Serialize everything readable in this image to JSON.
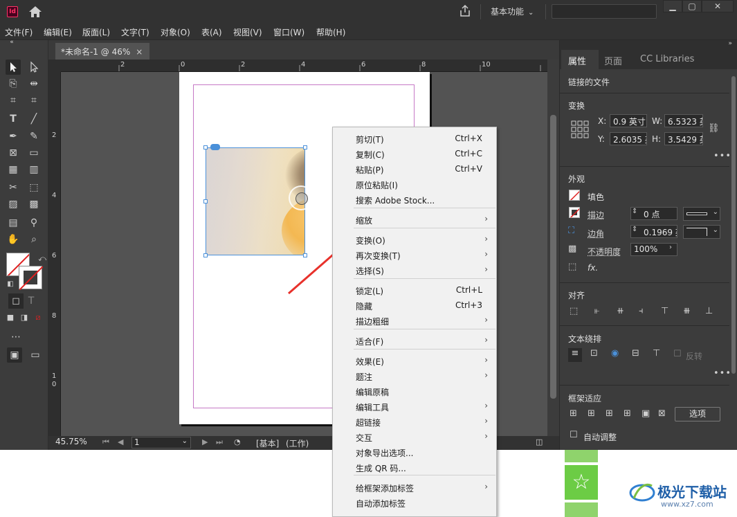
{
  "app": {
    "logo_text": "Id",
    "workspace": "基本功能"
  },
  "menubar": [
    "文件(F)",
    "编辑(E)",
    "版面(L)",
    "文字(T)",
    "对象(O)",
    "表(A)",
    "视图(V)",
    "窗口(W)",
    "帮助(H)"
  ],
  "document_tab": {
    "title": "*未命名-1 @ 46%",
    "close_glyph": "×"
  },
  "ruler_h_labels": [
    "2",
    "0",
    "2",
    "4",
    "6",
    "8",
    "10"
  ],
  "ruler_v_labels": [
    "2",
    "4",
    "6",
    "8",
    "1",
    "0"
  ],
  "statusbar": {
    "zoom": "45.75%",
    "page": "1",
    "style": "[基本]",
    "mode": "(工作)"
  },
  "panel": {
    "tabs": [
      "属性",
      "页面",
      "CC Libraries"
    ],
    "linked_file": "链接的文件",
    "transform": {
      "title": "变换",
      "x_label": "X:",
      "x_value": "0.9 英寸",
      "y_label": "Y:",
      "y_value": "2.6035 英",
      "w_label": "W:",
      "w_value": "6.5323 英",
      "h_label": "H:",
      "h_value": "3.5429 英"
    },
    "appearance": {
      "title": "外观",
      "fill_label": "填色",
      "stroke_label": "描边",
      "stroke_value": "0 点",
      "corner_label": "边角",
      "corner_value": "0.1969 英",
      "opacity_label": "不透明度",
      "opacity_value": "100%",
      "fx_label": "fx."
    },
    "align_title": "对齐",
    "text_wrap": {
      "title": "文本绕排",
      "invert_label": "反转"
    },
    "frame_fitting": {
      "title": "框架适应",
      "options_button": "选项",
      "auto_fit_label": "自动调整"
    },
    "more_glyph": "•••"
  },
  "context_menu": {
    "items": [
      {
        "label": "剪切(T)",
        "shortcut": "Ctrl+X",
        "submenu": false
      },
      {
        "label": "复制(C)",
        "shortcut": "Ctrl+C",
        "submenu": false
      },
      {
        "label": "粘贴(P)",
        "shortcut": "Ctrl+V",
        "submenu": false
      },
      {
        "label": "原位粘贴(I)",
        "shortcut": "",
        "submenu": false
      },
      {
        "label": "搜索 Adobe Stock...",
        "shortcut": "",
        "submenu": false
      },
      {
        "label": "缩放",
        "shortcut": "",
        "submenu": true
      },
      {
        "label": "变换(O)",
        "shortcut": "",
        "submenu": true
      },
      {
        "label": "再次变换(T)",
        "shortcut": "",
        "submenu": true
      },
      {
        "label": "选择(S)",
        "shortcut": "",
        "submenu": true
      },
      {
        "label": "锁定(L)",
        "shortcut": "Ctrl+L",
        "submenu": false
      },
      {
        "label": "隐藏",
        "shortcut": "Ctrl+3",
        "submenu": false
      },
      {
        "label": "描边粗细",
        "shortcut": "",
        "submenu": true
      },
      {
        "label": "适合(F)",
        "shortcut": "",
        "submenu": true
      },
      {
        "label": "效果(E)",
        "shortcut": "",
        "submenu": true
      },
      {
        "label": "题注",
        "shortcut": "",
        "submenu": true
      },
      {
        "label": "编辑原稿",
        "shortcut": "",
        "submenu": false
      },
      {
        "label": "编辑工具",
        "shortcut": "",
        "submenu": true
      },
      {
        "label": "超链接",
        "shortcut": "",
        "submenu": true
      },
      {
        "label": "交互",
        "shortcut": "",
        "submenu": true
      },
      {
        "label": "对象导出选项...",
        "shortcut": "",
        "submenu": false
      },
      {
        "label": "生成 QR 码...",
        "shortcut": "",
        "submenu": false
      },
      {
        "label": "给框架添加标签",
        "shortcut": "",
        "submenu": true
      },
      {
        "label": "自动添加标签",
        "shortcut": "",
        "submenu": false
      }
    ],
    "arrow_glyph": "›"
  },
  "watermark": {
    "title": "极光下载站",
    "subtitle": "www.xz7.com"
  },
  "colors": {
    "annotation_arrow": "#e8312b",
    "selection": "#4a90d9",
    "margin_guide": "#c678c6",
    "green_button": "#6ccc45"
  }
}
